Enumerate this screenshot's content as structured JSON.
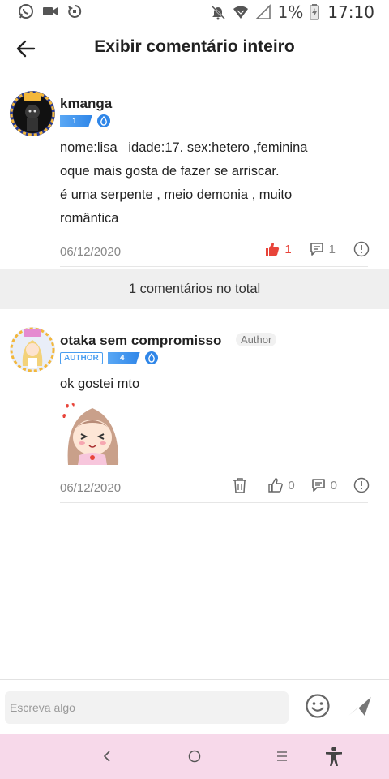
{
  "status_bar": {
    "battery_percent": "1%",
    "time": "17:10",
    "left_icons": [
      "whatsapp-icon",
      "video-camera-icon",
      "sync-icon"
    ],
    "right_icons": [
      "bell-off-icon",
      "wifi-icon",
      "signal-icon",
      "battery-charging-icon"
    ]
  },
  "header": {
    "title": "Exibir comentário inteiro",
    "back_icon": "arrow-left-icon"
  },
  "post": {
    "username": "kmanga",
    "level": "1",
    "body_lines": [
      "nome:lisa   idade:17. sex:hetero ,feminina",
      "oque mais gosta de fazer se arriscar.",
      "é uma serpente , meio demonia , muito",
      "romântica"
    ],
    "date": "06/12/2020",
    "likes": "1",
    "replies": "1",
    "liked": true,
    "like_color": "#e8443a"
  },
  "summary": {
    "total_label": "1 comentários no total"
  },
  "reply": {
    "username": "otaka sem compromisso",
    "author_tag": "Author",
    "author_chip": "AUTHOR",
    "level": "4",
    "text": "ok gostei mto",
    "sticker": "anime-girl-sticker",
    "date": "06/12/2020",
    "likes": "0",
    "replies": "0"
  },
  "composer": {
    "placeholder": "Escreva algo",
    "emoji_icon": "smiley-icon",
    "send_icon": "send-icon"
  },
  "nav_bar": {
    "background": "#f7d9ea",
    "buttons": [
      "back-chevron-icon",
      "home-circle-icon",
      "recents-icon",
      "accessibility-icon"
    ]
  },
  "colors": {
    "accent_blue": "#2f86e8",
    "text_primary": "#222222",
    "text_muted": "#888888"
  }
}
